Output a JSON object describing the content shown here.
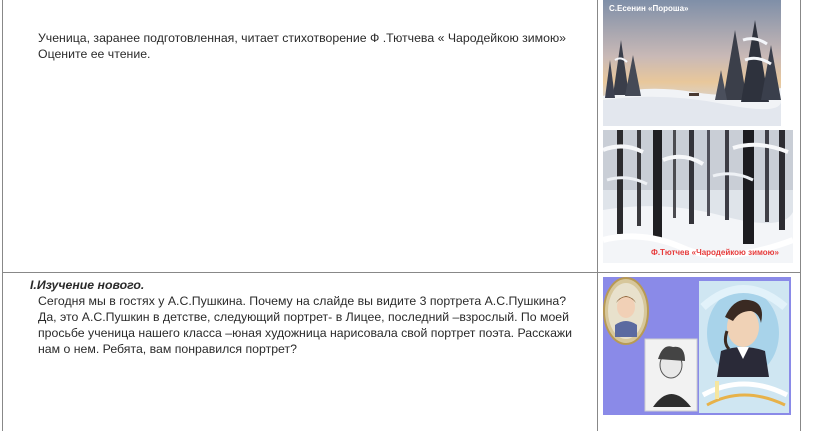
{
  "row1": {
    "text": "Ученица, заранее подготовленная, читает стихотворение Ф .Тютчева « Чародейкою зимою» Оцените ее чтение.",
    "picture1_caption": "С.Есенин «Пороша»",
    "picture2_caption": "Ф.Тютчев «Чародейкою зимою»"
  },
  "row2": {
    "heading": "I.Изучение нового.",
    "line1": "Сегодня мы в гостях у А.С.Пушкина. Почему на слайде вы видите 3 портрета А.С.Пушкина?",
    "line2": "Да, это А.С.Пушкин в детстве, следующий портрет- в Лицее, последний –взрослый. По моей просьбе ученица нашего класса –юная художница нарисовала свой портрет поэта. Расскажи нам о нем. Ребята, вам понравился портрет?"
  }
}
